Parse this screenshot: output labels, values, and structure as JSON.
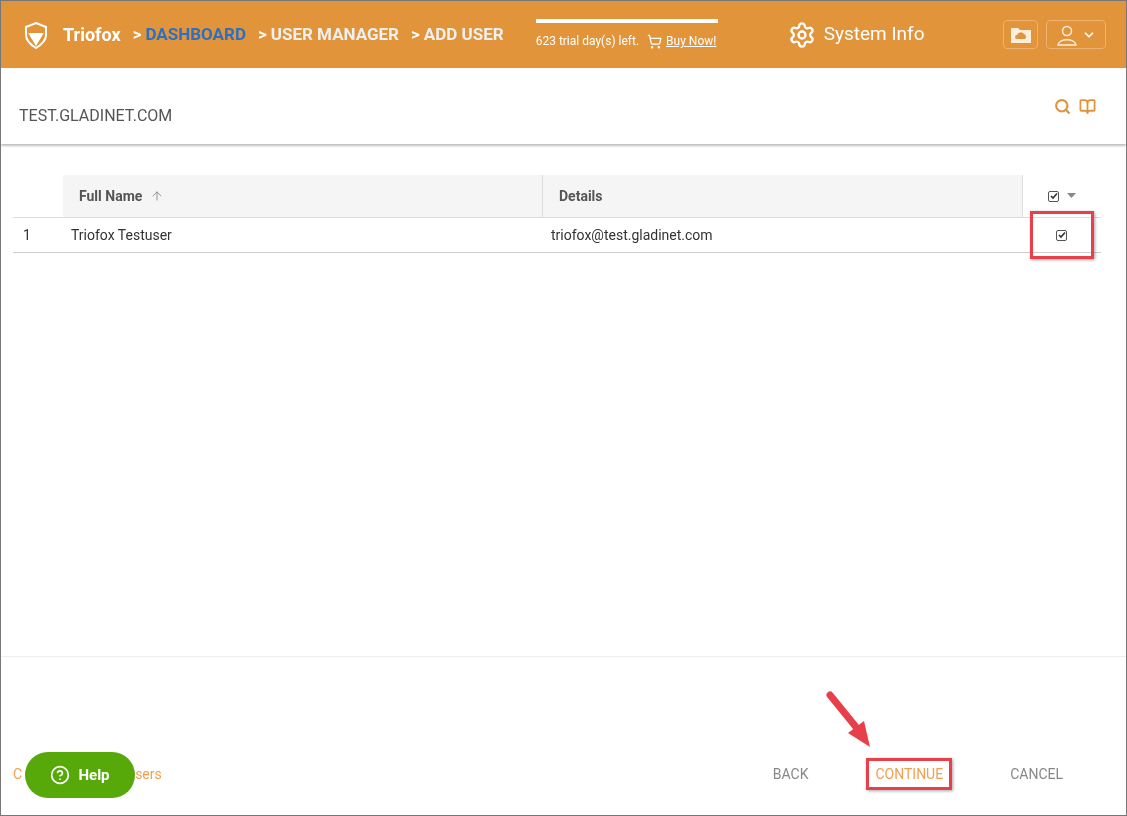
{
  "header": {
    "brand": "Triofox",
    "breadcrumbs": [
      {
        "separator": ">",
        "label": "DASHBOARD",
        "kind": "link"
      },
      {
        "separator": ">",
        "label": "USER MANAGER",
        "kind": "text"
      },
      {
        "separator": ">",
        "label": "ADD USER",
        "kind": "text"
      }
    ],
    "trial": {
      "text": "623 trial day(s) left.",
      "link": "Buy Now!"
    },
    "system_info": "System Info"
  },
  "domain": "TEST.GLADINET.COM",
  "table": {
    "columns": [
      {
        "label": "Full Name",
        "sorted": true
      },
      {
        "label": "Details",
        "sorted": false
      }
    ],
    "select_all_checked": true,
    "rows": [
      {
        "index": "1",
        "name": "Triofox Testuser",
        "details": "triofox@test.gladinet.com",
        "checked": true,
        "highlighted": true
      }
    ]
  },
  "footer": {
    "link_visible_parts": [
      "C",
      "sers"
    ],
    "help": "Help",
    "buttons": [
      {
        "label": "BACK",
        "primary": false,
        "highlighted": false
      },
      {
        "label": "CONTINUE",
        "primary": true,
        "highlighted": true
      },
      {
        "label": "CANCEL",
        "primary": false,
        "highlighted": false
      }
    ]
  }
}
